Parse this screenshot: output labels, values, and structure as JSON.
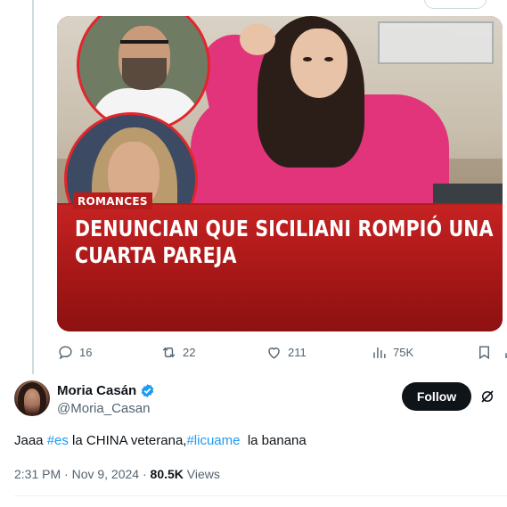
{
  "media": {
    "tag": "ROMANCES",
    "headline_line1": "DENUNCIAN QUE SICILIANI ROMPIÓ UNA",
    "headline_line2": "CUARTA PAREJA"
  },
  "actions": {
    "replies": "16",
    "reposts": "22",
    "likes": "211",
    "views": "75K"
  },
  "reply": {
    "display_name": "Moria Casán",
    "handle": "@Moria_Casan",
    "follow_label": "Follow",
    "text": {
      "part1": "Jaaa ",
      "hashtag1": "#es",
      "part2": " la CHINA veterana,",
      "hashtag2": "#licuame",
      "part3": "  la banana"
    },
    "meta": {
      "time_date": "2:31 PM · Nov 9, 2024 · ",
      "views_count": "80.5K",
      "views_label": " Views"
    }
  },
  "colors": {
    "accent": "#1d9bf0",
    "text": "#0f1419",
    "muted": "#536471",
    "headline_red": "#b71c1c",
    "jacket_pink": "#e1347a"
  }
}
